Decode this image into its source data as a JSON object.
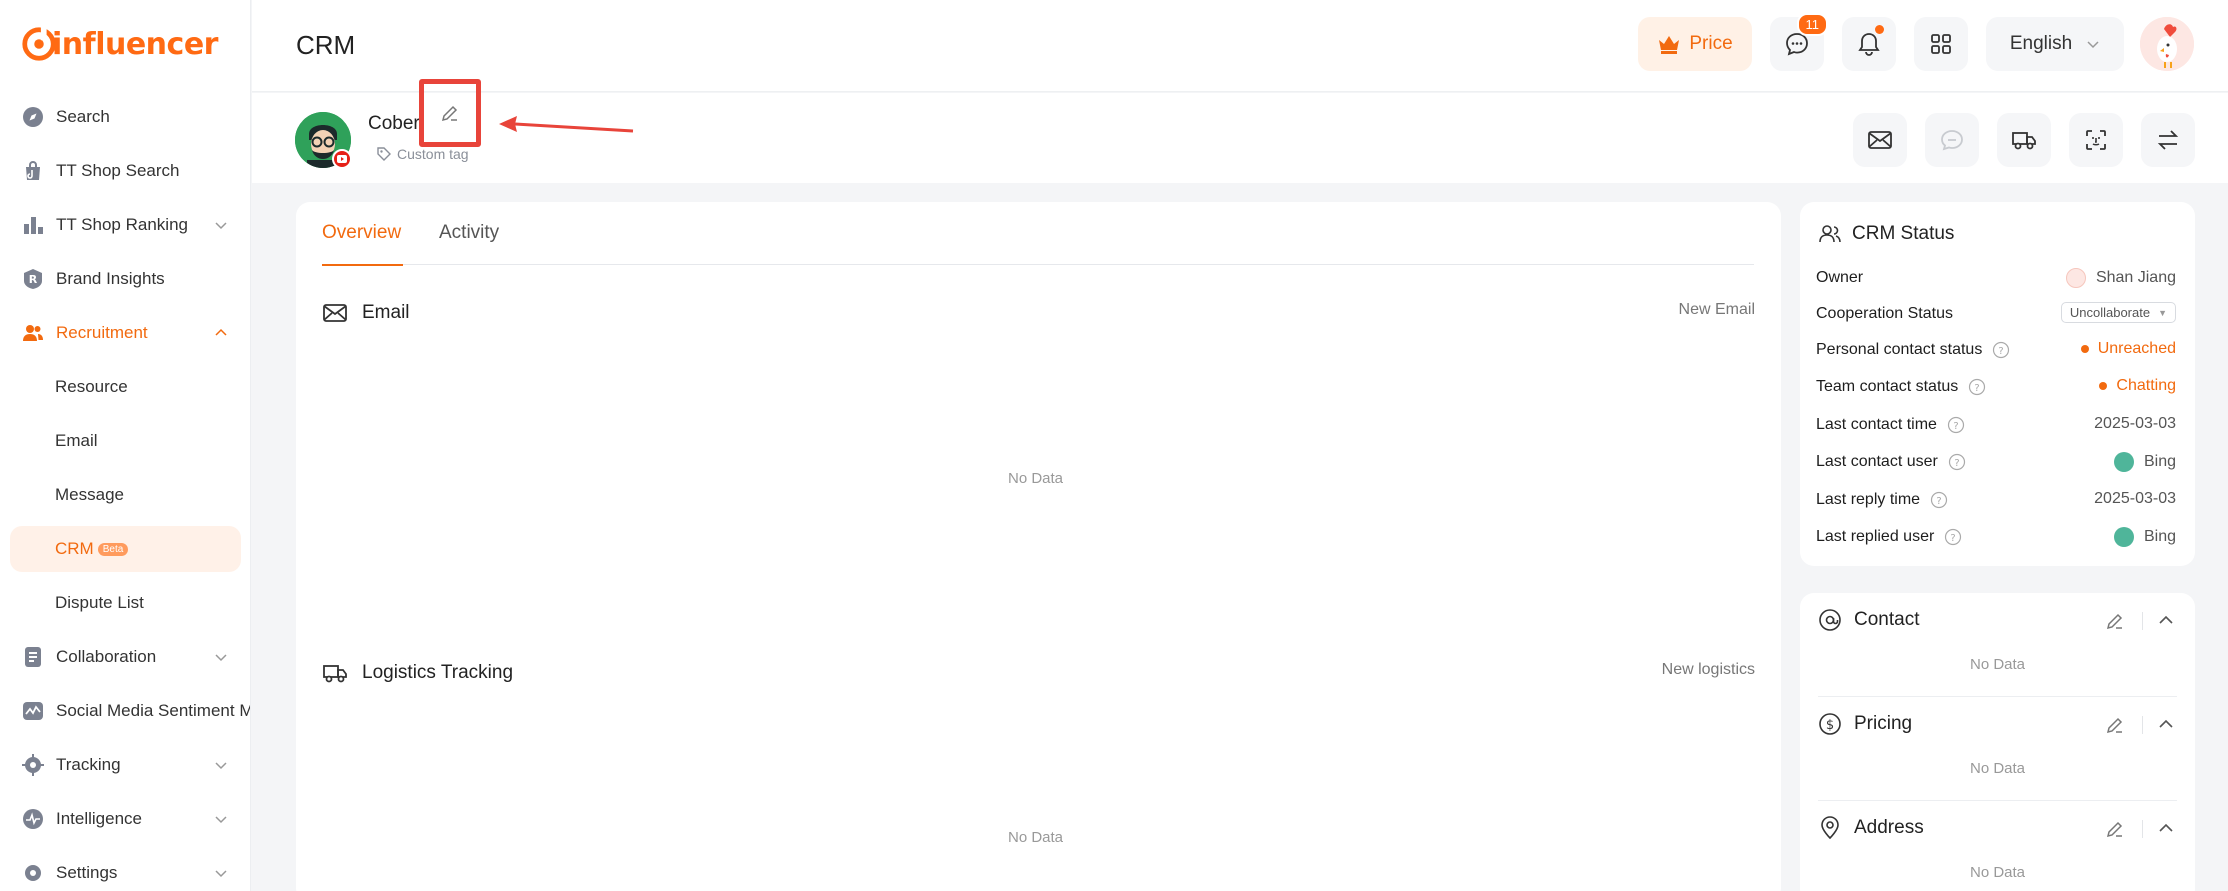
{
  "brand": {
    "name": "influencer",
    "accent": "#f26a0f"
  },
  "sidebar": {
    "items": [
      {
        "label": "Search"
      },
      {
        "label": "TT Shop Search"
      },
      {
        "label": "TT Shop Ranking"
      },
      {
        "label": "Brand Insights"
      },
      {
        "label": "Recruitment"
      },
      {
        "label": "Collaboration"
      },
      {
        "label": "Social Media Sentiment M"
      },
      {
        "label": "Tracking"
      },
      {
        "label": "Intelligence"
      },
      {
        "label": "Settings"
      }
    ],
    "recruitment_sub": [
      {
        "label": "Resource"
      },
      {
        "label": "Email"
      },
      {
        "label": "Message"
      },
      {
        "label": "CRM",
        "badge": "Beta"
      },
      {
        "label": "Dispute List"
      }
    ]
  },
  "header": {
    "title": "CRM",
    "price_label": "Price",
    "message_count": "11",
    "language": "English"
  },
  "profile": {
    "name": "Cober",
    "custom_tag": "Custom tag"
  },
  "main": {
    "tabs": [
      {
        "label": "Overview"
      },
      {
        "label": "Activity"
      }
    ],
    "email": {
      "title": "Email",
      "action": "New Email",
      "empty": "No Data"
    },
    "logistics": {
      "title": "Logistics Tracking",
      "action": "New logistics",
      "empty": "No Data"
    }
  },
  "crm_status": {
    "title": "CRM Status",
    "rows": [
      {
        "label": "Owner",
        "value": "Shan Jiang"
      },
      {
        "label": "Cooperation Status",
        "value": "Uncollaborate"
      },
      {
        "label": "Personal contact status",
        "value": "Unreached"
      },
      {
        "label": "Team contact status",
        "value": "Chatting"
      },
      {
        "label": "Last contact time",
        "value": "2025-03-03"
      },
      {
        "label": "Last contact user",
        "value": "Bing"
      },
      {
        "label": "Last reply time",
        "value": "2025-03-03"
      },
      {
        "label": "Last replied user",
        "value": "Bing"
      }
    ]
  },
  "info_sections": [
    {
      "title": "Contact",
      "empty": "No Data"
    },
    {
      "title": "Pricing",
      "empty": "No Data"
    },
    {
      "title": "Address",
      "empty": "No Data"
    }
  ]
}
